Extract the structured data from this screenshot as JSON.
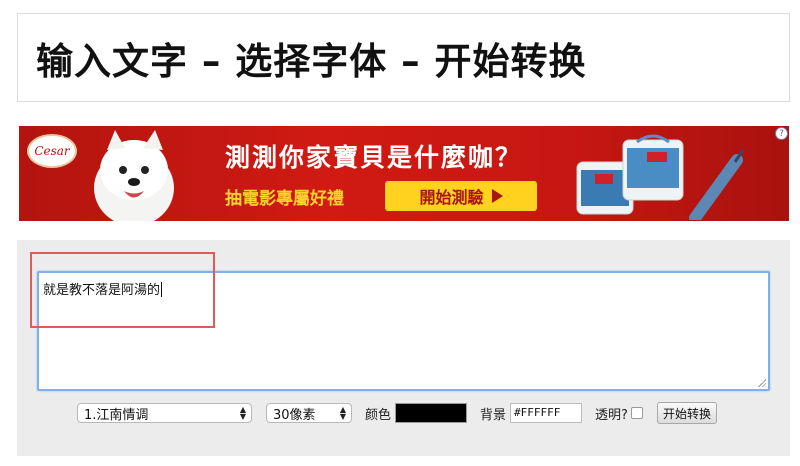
{
  "header": {
    "title": "输入文字 – 选择字体 – 开始转换"
  },
  "ad": {
    "brand": "Cesar",
    "headline": "測測你家寶貝是什麼咖？",
    "subline": "抽電影專屬好禮",
    "cta_label": "開始測驗",
    "info_icon": "?",
    "colors": {
      "background": "#c81712",
      "cta": "#ffd21f",
      "subline": "#ffd22e"
    }
  },
  "converter": {
    "input_text": "就是教不落是阿湯的",
    "font_select": {
      "value": "1.江南情调"
    },
    "size_select": {
      "value": "30像素"
    },
    "color_label": "颜色",
    "color_value": "#000000",
    "bg_label": "背景",
    "bg_value": "#FFFFFF",
    "transparent_label": "透明?",
    "convert_button": "开始转换",
    "colors": {
      "focus_border": "#7fb0e8",
      "highlight": "#e2595a",
      "panel": "#ececec"
    }
  }
}
